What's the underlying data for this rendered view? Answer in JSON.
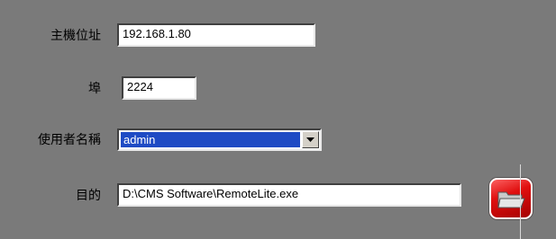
{
  "form": {
    "host": {
      "label": "主機位址",
      "value": "192.168.1.80"
    },
    "port": {
      "label": "埠",
      "value": "2224"
    },
    "user": {
      "label": "使用者名稱",
      "value": "admin"
    },
    "target": {
      "label": "目的",
      "value": "D:\\CMS Software\\RemoteLite.exe"
    }
  },
  "icons": {
    "dropdown": "chevron-down-icon",
    "browse": "folder-icon"
  },
  "colors": {
    "background": "#7a7a7a",
    "selection": "#1f4bc4",
    "browse_button": "#e01010"
  }
}
